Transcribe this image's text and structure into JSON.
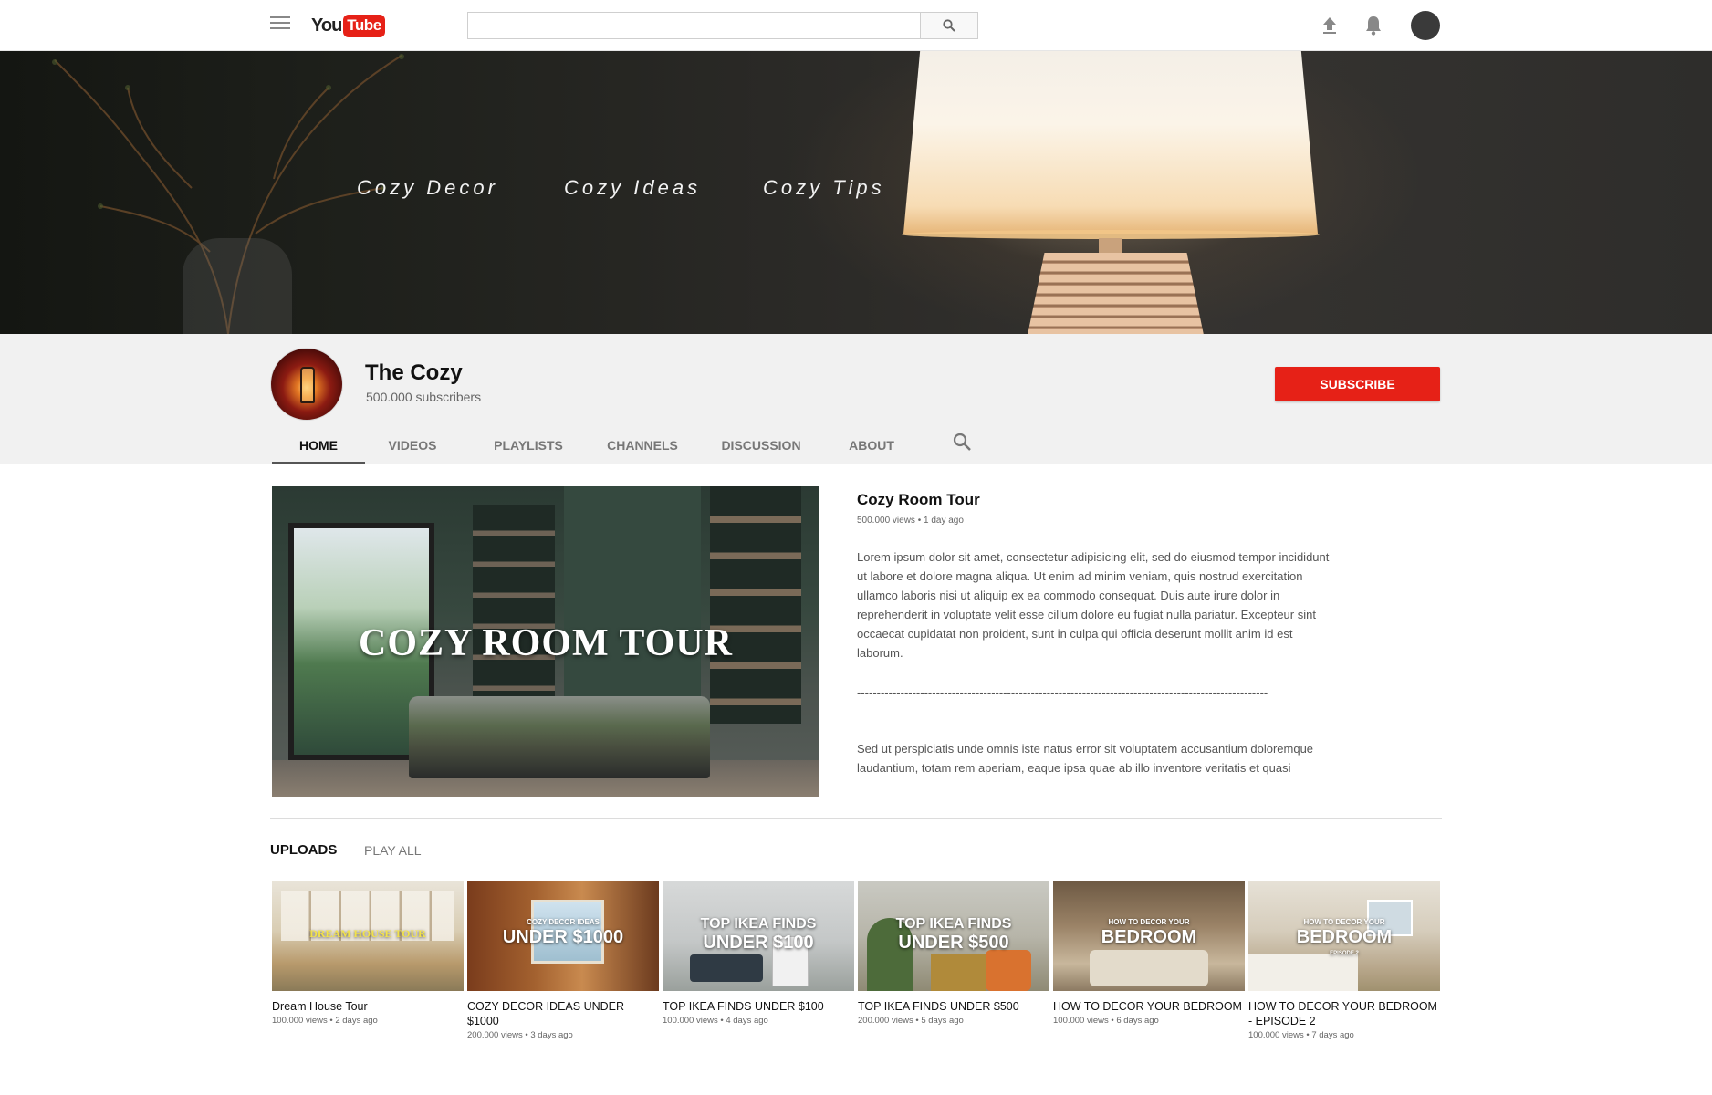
{
  "header": {
    "logo_you": "You",
    "logo_tube": "Tube",
    "search_placeholder": "",
    "search_value": ""
  },
  "banner": {
    "links": [
      "Cozy Decor",
      "Cozy Ideas",
      "Cozy Tips"
    ]
  },
  "channel": {
    "name": "The Cozy",
    "subscribers": "500.000 subscribers",
    "subscribe_label": "SUBSCRIBE",
    "tabs": [
      "HOME",
      "VIDEOS",
      "PLAYLISTS",
      "CHANNELS",
      "DISCUSSION",
      "ABOUT"
    ],
    "active_tab": "HOME"
  },
  "featured": {
    "thumb_text": "COZY ROOM TOUR",
    "title": "Cozy Room Tour",
    "meta": "500.000 views • 1 day ago",
    "description": "Lorem ipsum dolor sit amet, consectetur adipisicing elit, sed do eiusmod tempor incididunt ut labore et dolore magna aliqua. Ut enim ad minim veniam, quis nostrud exercitation ullamco laboris nisi ut aliquip ex ea commodo consequat. Duis aute irure dolor in reprehenderit in voluptate velit esse cillum dolore eu fugiat nulla pariatur. Excepteur sint occaecat cupidatat non proident, sunt in culpa qui officia deserunt mollit anim id est laborum.",
    "separator": "--------------------------------------------------------------------------------------------------------",
    "description2": "Sed ut perspiciatis unde omnis iste natus error sit voluptatem accusantium doloremque laudantium, totam rem aperiam, eaque ipsa quae ab illo inventore veritatis et quasi"
  },
  "uploads": {
    "label": "UPLOADS",
    "play_all": "PLAY ALL",
    "videos": [
      {
        "title": "Dream House Tour",
        "meta": "100.000 views • 2 days ago",
        "thumb_line1": "",
        "thumb_line2": "DREAM HOUSE TOUR"
      },
      {
        "title": "COZY DECOR IDEAS UNDER $1000",
        "meta": "200.000 views • 3 days ago",
        "thumb_line1": "COZY DECOR IDEAS",
        "thumb_line2": "UNDER $1000"
      },
      {
        "title": "TOP IKEA FINDS UNDER $100",
        "meta": "100.000 views • 4 days ago",
        "thumb_line1": "TOP IKEA FINDS",
        "thumb_line2": "UNDER $100"
      },
      {
        "title": "TOP IKEA FINDS UNDER $500",
        "meta": "200.000 views • 5 days ago",
        "thumb_line1": "TOP IKEA FINDS",
        "thumb_line2": "UNDER $500"
      },
      {
        "title": "HOW TO DECOR YOUR BEDROOM",
        "meta": "100.000 views • 6 days ago",
        "thumb_line1": "HOW TO DECOR YOUR",
        "thumb_line2": "BEDROOM"
      },
      {
        "title": "HOW TO DECOR YOUR BEDROOM - EPISODE 2",
        "meta": "100.000 views • 7 days ago",
        "thumb_line1": "HOW TO DECOR YOUR",
        "thumb_line2": "BEDROOM",
        "thumb_line3": "EPISODE 2"
      }
    ]
  },
  "colors": {
    "brand_red": "#e62117",
    "header_bg": "#f1f1f1"
  }
}
